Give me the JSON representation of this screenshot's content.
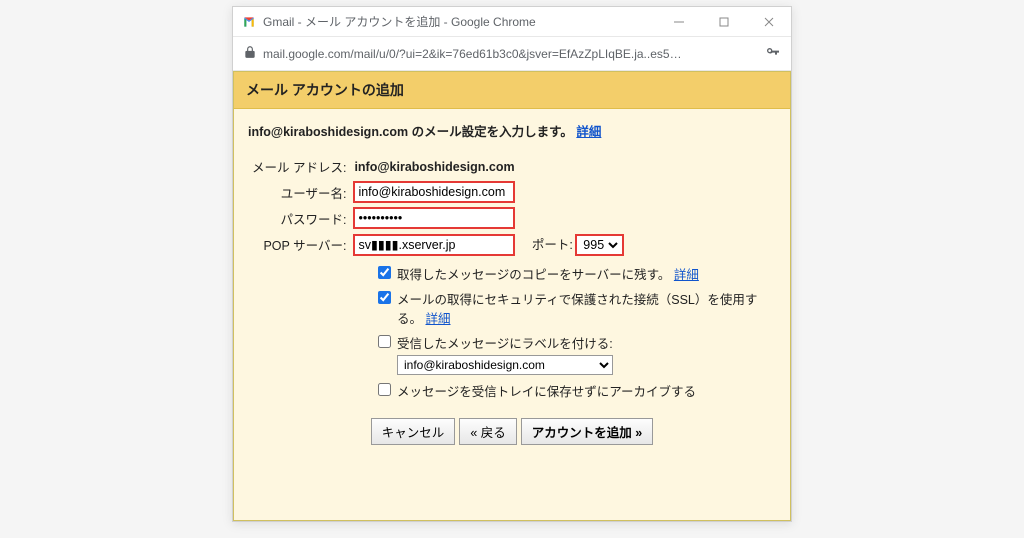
{
  "window": {
    "title": "Gmail - メール アカウントを追加 - Google Chrome"
  },
  "addressbar": {
    "url": "mail.google.com/mail/u/0/?ui=2&ik=76ed61b3c0&jsver=EfAzZpLIqBE.ja..es5…"
  },
  "page": {
    "header": "メール アカウントの追加",
    "lead_prefix": "info@kiraboshidesign.com のメール設定を入力します。",
    "lead_link": "詳細"
  },
  "form": {
    "email_label": "メール アドレス:",
    "email_value": "info@kiraboshidesign.com",
    "user_label": "ユーザー名:",
    "user_value": "info@kiraboshidesign.com",
    "pass_label": "パスワード:",
    "pass_value": "••••••••••",
    "pop_label": "POP サーバー:",
    "pop_value": "sv▮▮▮▮.xserver.jp",
    "port_label": "ポート:",
    "port_value": "995"
  },
  "options": {
    "leave_copy": "取得したメッセージのコピーをサーバーに残す。",
    "leave_copy_link": "詳細",
    "ssl": "メールの取得にセキュリティで保護された接続（SSL）を使用する。",
    "ssl_link": "詳細",
    "label_msg": "受信したメッセージにラベルを付ける:",
    "label_value": "info@kiraboshidesign.com",
    "archive": "メッセージを受信トレイに保存せずにアーカイブする"
  },
  "buttons": {
    "cancel": "キャンセル",
    "back": "« 戻る",
    "add": "アカウントを追加 »"
  }
}
